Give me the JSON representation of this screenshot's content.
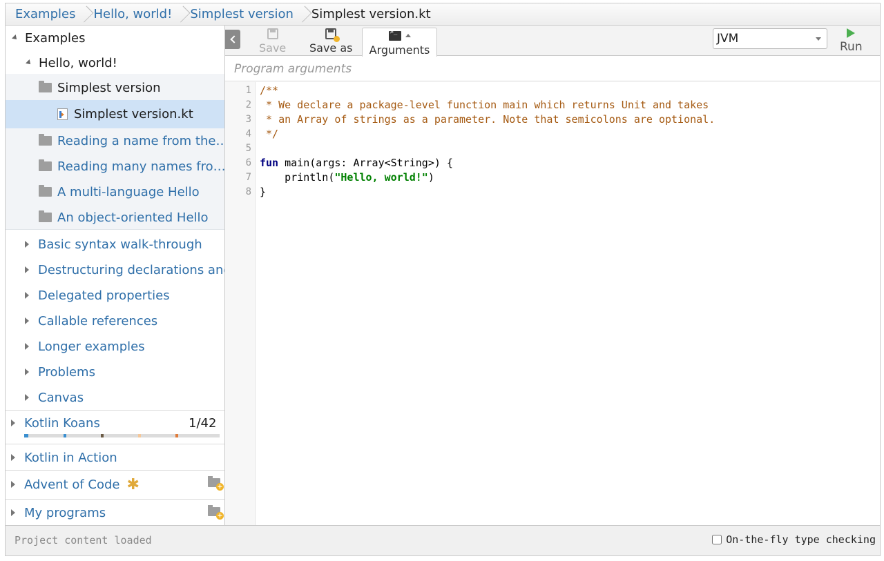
{
  "breadcrumb": [
    "Examples",
    "Hello, world!",
    "Simplest version",
    "Simplest version.kt"
  ],
  "sidebar": {
    "root": "Examples",
    "hello": "Hello, world!",
    "hello_children": [
      "Simplest version",
      "Reading a name from the…",
      "Reading many names fro…",
      "A multi-language Hello",
      "An object-oriented Hello"
    ],
    "file": "Simplest version.kt",
    "example_groups": [
      "Basic syntax walk-through",
      "Destructuring declarations and",
      "Delegated properties",
      "Callable references",
      "Longer examples",
      "Problems",
      "Canvas"
    ],
    "koans": {
      "label": "Kotlin Koans",
      "progress_text": "1/42"
    },
    "kotlin_in_action": "Kotlin in Action",
    "advent": "Advent of Code",
    "my_programs": "My programs"
  },
  "toolbar": {
    "save": "Save",
    "save_as": "Save as",
    "arguments": "Arguments",
    "platform": "JVM",
    "run": "Run"
  },
  "args": {
    "placeholder": "Program arguments"
  },
  "code": {
    "line_numbers": [
      "1",
      "2",
      "3",
      "4",
      "5",
      "6",
      "7",
      "8"
    ],
    "l1": "/**",
    "l2": " * We declare a package-level function main which returns Unit and takes",
    "l3": " * an Array of strings as a parameter. Note that semicolons are optional.",
    "l4": " */",
    "l6_kw": "fun",
    "l6_rest": " main(args: Array<String>) {",
    "l7_a": "    println(",
    "l7_str": "\"Hello, world!\"",
    "l7_b": ")",
    "l8": "}"
  },
  "status": {
    "message": "Project content loaded",
    "otf_label": "On-the-fly type checking"
  },
  "colors": {
    "link": "#2f6fa9",
    "selected": "#cfe2f6",
    "comment": "#a55a12",
    "keyword": "#000080",
    "string": "#008000",
    "run": "#4caf50",
    "progress_marks": [
      "#3a8fd0",
      "#3a8fd0",
      "#6b5b45",
      "#f5c89a",
      "#e07b3a"
    ]
  }
}
